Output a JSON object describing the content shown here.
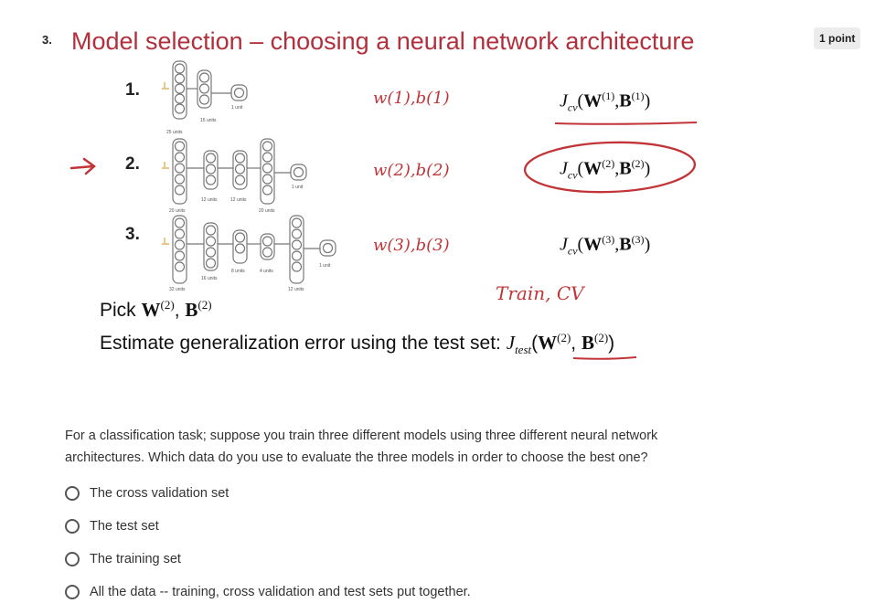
{
  "question": {
    "number": "3.",
    "points": "1 point",
    "text": "For a classification task; suppose you train three different models using three different neural network architectures. Which data do you use to evaluate the three models in order to choose the best one?"
  },
  "slide": {
    "title": "Model selection – choosing a neural network architecture",
    "rows": [
      {
        "num": "1.",
        "params": "w(1),b(1)",
        "cost_sup": "(1)",
        "units": [
          "25 units",
          "15 units",
          "1 unit"
        ]
      },
      {
        "num": "2.",
        "params": "w(2),b(2)",
        "cost_sup": "(2)",
        "units": [
          "20 units",
          "12 units",
          "12 units",
          "20 units",
          "1 unit"
        ]
      },
      {
        "num": "3.",
        "params": "w(3),b(3)",
        "cost_sup": "(3)",
        "units": [
          "32 units",
          "16 units",
          "8 units",
          "4 units",
          "12 units",
          "1 unit"
        ]
      }
    ],
    "cost_name": "J",
    "cost_sub": "cv",
    "W": "W",
    "B": "B",
    "train_cv": "Train, CV",
    "pick_label": "Pick",
    "pick_sup": "(2)",
    "estimate_label": "Estimate generalization error using the test set:",
    "test_sub": "test",
    "accent_color": "#c13437",
    "title_color": "#b1303c"
  },
  "options": [
    {
      "label": "The cross validation set"
    },
    {
      "label": "The test set"
    },
    {
      "label": "The training set"
    },
    {
      "label": "All the data -- training, cross validation and test sets put together."
    }
  ]
}
